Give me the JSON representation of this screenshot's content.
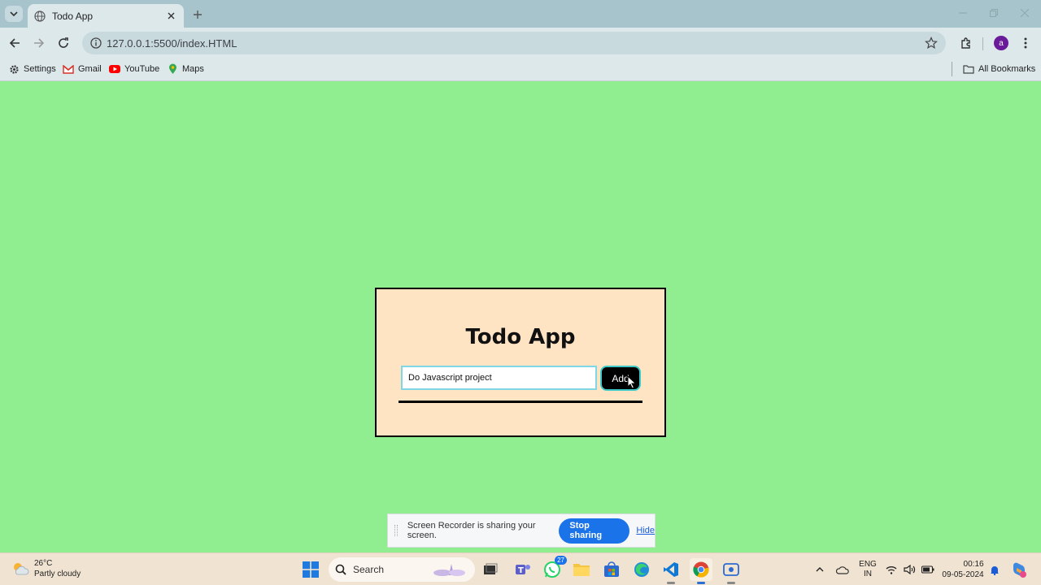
{
  "browser": {
    "tab": {
      "title": "Todo App"
    },
    "address": {
      "url": "127.0.0.1:5500/index.HTML"
    },
    "bookmarks": [
      {
        "label": "Settings"
      },
      {
        "label": "Gmail"
      },
      {
        "label": "YouTube"
      },
      {
        "label": "Maps"
      }
    ],
    "all_bookmarks_label": "All Bookmarks",
    "profile_initial": "a"
  },
  "app": {
    "title": "Todo App",
    "input": {
      "value": "Do Javascript project"
    },
    "add_label": "Add"
  },
  "sharing": {
    "message": "Screen Recorder is sharing your screen.",
    "stop_label": "Stop sharing",
    "hide_label": "Hide"
  },
  "taskbar": {
    "weather": {
      "temp": "26°C",
      "condition": "Partly cloudy"
    },
    "search_placeholder": "Search",
    "whatsapp_badge": "27",
    "lang_top": "ENG",
    "lang_bottom": "IN",
    "time": "00:16",
    "date": "09-05-2024"
  },
  "colors": {
    "page_bg": "#90ee90",
    "card_bg": "#ffe4c4",
    "button_bg": "#000000",
    "input_border": "#7fd6e4",
    "stop_sharing": "#1a73e8"
  }
}
